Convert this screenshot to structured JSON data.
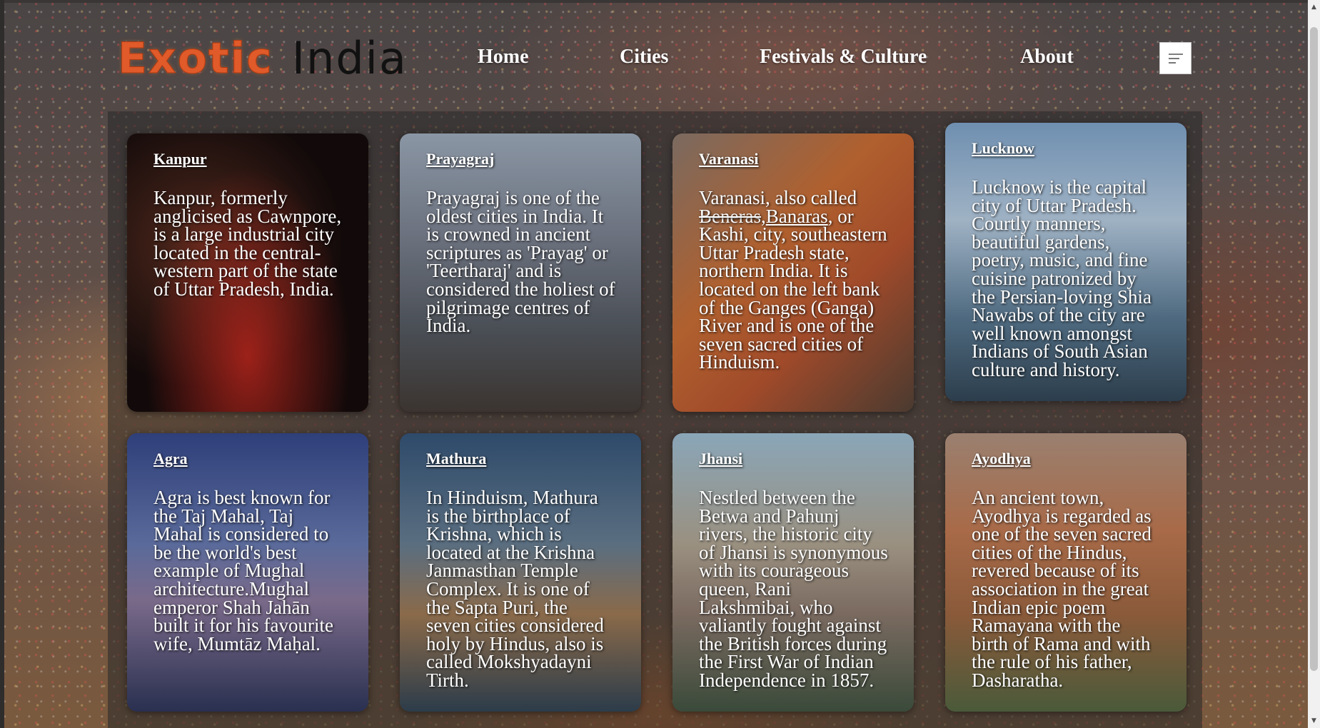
{
  "logo": {
    "part1": "Exotic",
    "part2": "India"
  },
  "nav": {
    "home": "Home",
    "cities": "Cities",
    "festivals": "Festivals & Culture",
    "about": "About"
  },
  "icons": {
    "menu": "menu-lines-icon",
    "scroll_up": "chevron-up-icon",
    "scroll_down": "chevron-down-icon"
  },
  "colors": {
    "logo_accent": "#e05a2a",
    "text": "#ffffff"
  },
  "cities": [
    {
      "title": "Kanpur",
      "desc": "Kanpur, formerly anglicised as Cawnpore, is a large industrial city located in the central-western part of the state of Uttar Pradesh, India."
    },
    {
      "title": "Prayagraj",
      "desc": "Prayagraj is one of the oldest cities in India. It is crowned in ancient scriptures as 'Prayag' or 'Teertharaj' and is considered the holiest of pilgrimage centres of India."
    },
    {
      "title": "Varanasi",
      "desc_pre": "Varanasi, also called ",
      "desc_strike": "Beneras",
      "desc_sep": ",",
      "desc_link": "Banaras",
      "desc_post": ", or Kashi, city, southeastern Uttar Pradesh state, northern India. It is located on the left bank of the Ganges (Ganga) River and is one of the seven sacred cities of Hinduism."
    },
    {
      "title": "Lucknow",
      "desc": "Lucknow is the capital city of Uttar Pradesh. Courtly manners, beautiful gardens, poetry, music, and fine cuisine patronized by the Persian-loving Shia Nawabs of the city are well known amongst Indians of South Asian culture and history."
    },
    {
      "title": "Agra",
      "desc": "Agra is best known for the Taj Mahal, Taj Mahal is considered to be the world's best example of Mughal architecture.Mughal emperor Shah Jahān built it for his favourite wife, Mumtāz Maḥal."
    },
    {
      "title": "Mathura",
      "desc": "In Hinduism, Mathura is the birthplace of Krishna, which is located at the Krishna Janmasthan Temple Complex. It is one of the Sapta Puri, the seven cities considered holy by Hindus, also is called Mokshyadayni Tirth."
    },
    {
      "title": "Jhansi",
      "desc": "Nestled between the Betwa and Pahunj rivers, the historic city of Jhansi is synonymous with its courageous queen, Rani Lakshmibai, who valiantly fought against the British forces during the First War of Indian Independence in 1857."
    },
    {
      "title": "Ayodhya",
      "desc": "An ancient town, Ayodhya is regarded as one of the seven sacred cities of the Hindus, revered because of its association in the great Indian epic poem Ramayana with the birth of Rama and with the rule of his father, Dasharatha."
    }
  ]
}
